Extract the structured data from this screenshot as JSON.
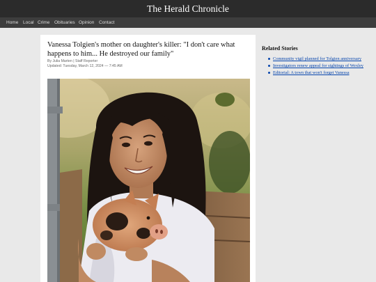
{
  "site": {
    "title": "The Herald Chronicle"
  },
  "nav": {
    "items": [
      {
        "label": "Home"
      },
      {
        "label": "Local"
      },
      {
        "label": "Crime"
      },
      {
        "label": "Obituaries"
      },
      {
        "label": "Opinion"
      },
      {
        "label": "Contact"
      }
    ]
  },
  "article": {
    "headline": "Vanessa Tolgien's mother on daughter's killer: \"I don't care what happens to him... He destroyed our family\"",
    "byline": "By Julia Marten | Staff Reporter",
    "updated": "Updated: Tuesday, March 12, 2024 — 7:45 AM"
  },
  "sidebar": {
    "heading": "Related Stories",
    "links": [
      {
        "label": "Community vigil planned for Tolgien anniversary"
      },
      {
        "label": "Investigators renew appeal for sightings of Wexley"
      },
      {
        "label": "Editorial: A town that won't forget Vanessa"
      }
    ]
  },
  "colors": {
    "masthead": "#2b2b2b",
    "nav": "#3d3d3d",
    "link": "#0645ad",
    "page_bg": "#e9e9e9"
  }
}
